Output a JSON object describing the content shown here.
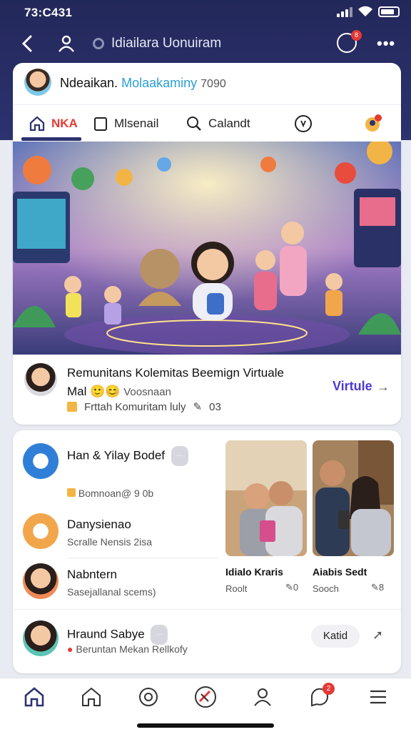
{
  "status_bar": {
    "time": "73:C431"
  },
  "header": {
    "title": "Idiailara Uonuiram",
    "notification_count": "8"
  },
  "profile": {
    "name": "Ndeaikan.",
    "name_highlight": "Molaakaminy",
    "name_suffix": "7090"
  },
  "tabs": [
    {
      "label": "NKA",
      "icon": "home-icon"
    },
    {
      "label": "Mlsenail",
      "icon": "clipboard-icon"
    },
    {
      "label": "Calandt",
      "icon": "search-icon"
    },
    {
      "label": "",
      "icon": "clock-icon"
    },
    {
      "label": "",
      "icon": "avatar-badge-icon"
    }
  ],
  "post": {
    "title": "Remunitans Kolemitas Beemign Virtuale Mal",
    "subtitle": "Voosnaan",
    "meta_text": "Frttah Komuritam luly",
    "meta_count": "03",
    "cta": "Virtule"
  },
  "list": [
    {
      "title": "Han & Yilay Bodef",
      "pill": "···",
      "meta": "Bomnoan@",
      "count": "9 0b"
    },
    {
      "title": "Danysienao",
      "meta": "Scralle Nensis 2isa"
    },
    {
      "title": "Nabntern",
      "meta": "Sasejallanal scems)"
    },
    {
      "title": "Hraund Sabye",
      "pill": "···",
      "meta": "Beruntan Mekan Rellkofy"
    }
  ],
  "photos": [
    {
      "caption": "Idialo Kraris",
      "author": "Roolt",
      "likes": "0"
    },
    {
      "caption": "Aiabis Sedt",
      "author": "Sooch",
      "likes": "8"
    }
  ],
  "action_button": "Katid",
  "bottom_nav": {
    "badge": "2"
  },
  "colors": {
    "header": "#23285a",
    "accent": "#4b3ad0",
    "badge": "#e53935"
  }
}
